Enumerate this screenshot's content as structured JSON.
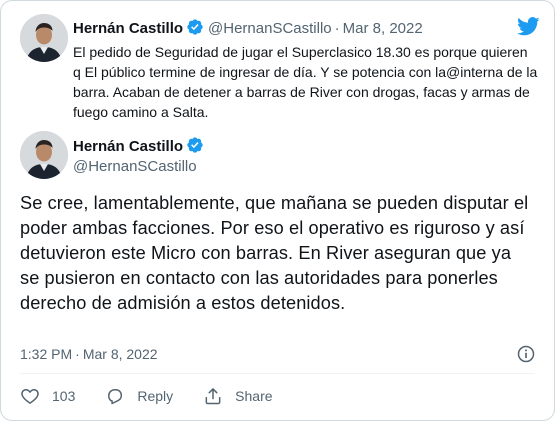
{
  "quoted": {
    "name": "Hernán Castillo",
    "handle": "@HernanSCastillo",
    "separator": "·",
    "date": "Mar 8, 2022",
    "text": "El pedido de Seguridad de jugar el Superclasico 18.30 es porque quieren q El público termine de ingresar de día. Y se potencia con la@interna de la barra. Acaban de detener a barras de River con drogas, facas y armas de fuego camino a Salta."
  },
  "tweet": {
    "name": "Hernán Castillo",
    "handle": "@HernanSCastillo",
    "text": "Se cree, lamentablemente, que mañana se pueden disputar el poder ambas facciones. Por eso el operativo es riguroso y así detuvieron este Micro con barras. En River aseguran que ya se pusieron en contacto con las autoridades para ponerles derecho de admisión a estos detenidos.",
    "time": "1:32 PM",
    "separator": "·",
    "date": "Mar 8, 2022"
  },
  "actions": {
    "like_count": "103",
    "reply_label": "Reply",
    "share_label": "Share"
  },
  "icons": {
    "brand": "twitter-bird-icon",
    "verified": "verified-badge-icon",
    "info": "info-icon",
    "like": "heart-icon",
    "reply": "reply-bubble-icon",
    "share": "share-icon"
  },
  "colors": {
    "brand_blue": "#1d9bf0",
    "text_primary": "#0f1419",
    "text_secondary": "#536471",
    "border": "#cfd9de"
  }
}
